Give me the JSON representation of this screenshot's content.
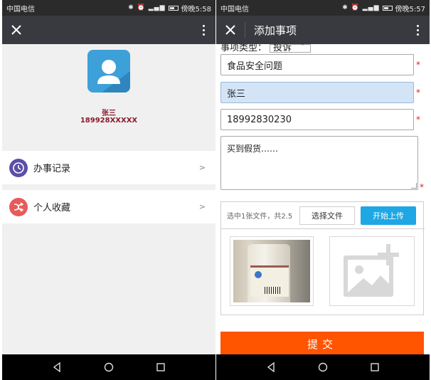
{
  "left": {
    "status": {
      "carrier": "中国电信",
      "time": "傍晚5:58"
    },
    "profile": {
      "name": "张三",
      "phone": "189928XXXXX"
    },
    "menu": [
      {
        "label": "办事记录",
        "arrow": ">",
        "icon": "clock-history-icon",
        "color": "#5b4fa8"
      },
      {
        "label": "个人收藏",
        "arrow": ">",
        "icon": "shuffle-icon",
        "color": "#e85a5a"
      }
    ]
  },
  "right": {
    "status": {
      "carrier": "中国电信",
      "time": "傍晚5:57"
    },
    "title": "添加事项",
    "form": {
      "type_label": "事项类型：",
      "type_value": "投诉",
      "subject": "食品安全问题",
      "name": "张三",
      "phone": "18992830230",
      "description": "买到假货……",
      "required_mark": "*"
    },
    "upload": {
      "status": "选中1张文件，共2.5",
      "choose_label": "选择文件",
      "start_label": "开始上传"
    },
    "submit_label": "提交"
  },
  "colors": {
    "titlebar": "#393a3f",
    "accent_blue": "#1ea7e4",
    "submit_orange": "#ff5400",
    "required_red": "#e02020",
    "name_red": "#8b1a2b"
  }
}
